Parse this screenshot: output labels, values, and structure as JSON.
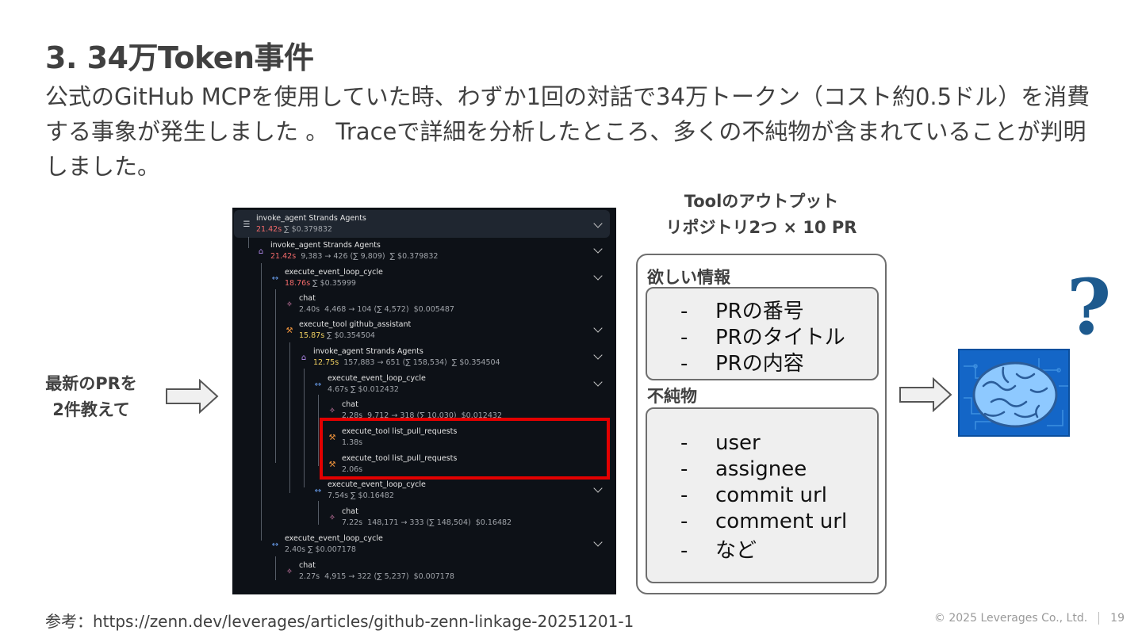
{
  "slide": {
    "title": "3. 34万Token事件",
    "subtitle": "公式のGitHub MCPを使用していた時、わずか1回の対話で34万トークン（コスト約0.5ドル）を消費する事象が発生しました 。 Traceで詳細を分析したところ、多くの不純物が含まれていることが判明しました。",
    "left_label_line1": "最新のPRを",
    "left_label_line2": "2件教えて",
    "tool_output_line1": "Toolのアウトプット",
    "tool_output_line2": "リポジトリ2つ × 10 PR",
    "wanted_label": "欲しい情報",
    "wanted_items": [
      "PRの番号",
      "PRのタイトル",
      "PRの内容"
    ],
    "impurity_label": "不純物",
    "impurity_items": [
      "user",
      "assignee",
      "commit url",
      "comment url",
      "など"
    ],
    "dash": "-",
    "reference": "参考：https://zenn.dev/leverages/articles/github-zenn-linkage-20251201-1",
    "copyright": "©  2025 Leverages Co., Ltd.",
    "page_number": "19"
  },
  "trace": {
    "nodes": [
      {
        "name": "invoke_agent Strands Agents",
        "dur": "21.42s",
        "meta": " ∑ $0.379832",
        "dur_color": "red",
        "icon": "list-icon"
      },
      {
        "name": "invoke_agent Strands Agents",
        "dur": "21.42s",
        "meta": "  9,383 → 426 (∑ 9,809)  ∑ $0.379832",
        "dur_color": "red",
        "icon": "robot-icon"
      },
      {
        "name": "execute_event_loop_cycle",
        "dur": "18.76s",
        "meta": " ∑ $0.35999",
        "dur_color": "red",
        "icon": "cycle-icon"
      },
      {
        "name": "chat",
        "dur": "2.40s",
        "meta": "  4,468 → 104 (∑ 4,572)  $0.005487",
        "dur_color": "plain",
        "icon": "chat-icon"
      },
      {
        "name": "execute_tool github_assistant",
        "dur": "15.87s",
        "meta": " ∑ $0.354504",
        "dur_color": "yellow",
        "icon": "wrench-icon"
      },
      {
        "name": "invoke_agent Strands Agents",
        "dur": "12.75s",
        "meta": "  157,883 → 651 (∑ 158,534)  ∑ $0.354504",
        "dur_color": "yellow",
        "icon": "robot-icon"
      },
      {
        "name": "execute_event_loop_cycle",
        "dur": "4.67s",
        "meta": " ∑ $0.012432",
        "dur_color": "plain",
        "icon": "cycle-icon"
      },
      {
        "name": "chat",
        "dur": "2.28s",
        "meta": "  9,712 → 318 (∑ 10,030)  $0.012432",
        "dur_color": "plain",
        "icon": "chat-icon"
      },
      {
        "name": "execute_tool list_pull_requests",
        "dur": "1.38s",
        "meta": "",
        "dur_color": "plain",
        "icon": "wrench-icon"
      },
      {
        "name": "execute_tool list_pull_requests",
        "dur": "2.06s",
        "meta": "",
        "dur_color": "plain",
        "icon": "wrench-icon"
      },
      {
        "name": "execute_event_loop_cycle",
        "dur": "7.54s",
        "meta": " ∑ $0.16482",
        "dur_color": "plain",
        "icon": "cycle-icon"
      },
      {
        "name": "chat",
        "dur": "7.22s",
        "meta": "  148,171 → 333 (∑ 148,504)  $0.16482",
        "dur_color": "plain",
        "icon": "chat-icon"
      },
      {
        "name": "execute_event_loop_cycle",
        "dur": "2.40s",
        "meta": " ∑ $0.007178",
        "dur_color": "plain",
        "icon": "cycle-icon"
      },
      {
        "name": "chat",
        "dur": "2.27s",
        "meta": "  4,915 → 322 (∑ 5,237)  $0.007178",
        "dur_color": "plain",
        "icon": "chat-icon"
      }
    ]
  },
  "colors": {
    "highlight": "#e30000",
    "brain_bg": "#1466c7",
    "qmark": "#1d5a8e"
  }
}
